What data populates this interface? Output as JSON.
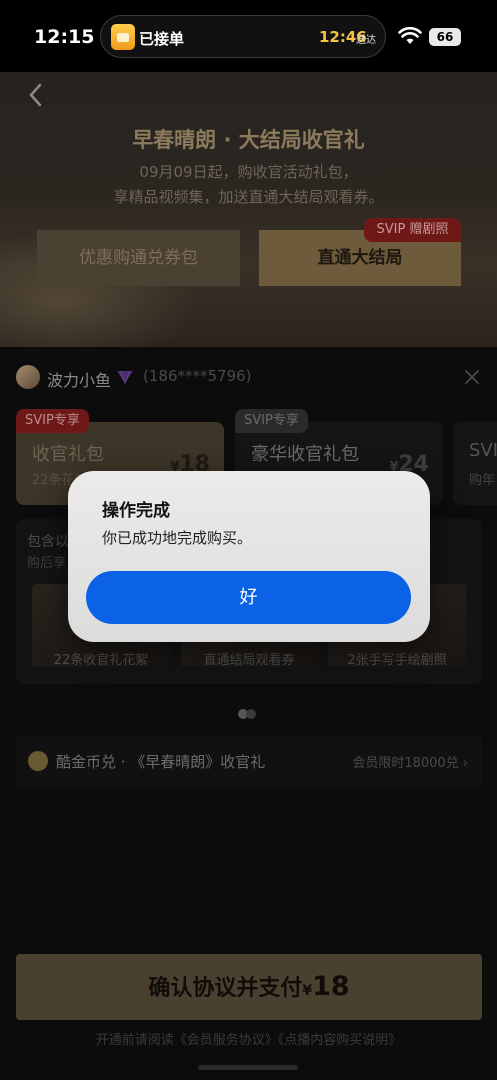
{
  "status_bar": {
    "time": "12:15",
    "island_text": "已接单",
    "island_time": "12:46",
    "island_sub": "送达",
    "battery": "66"
  },
  "banner": {
    "title": "早春晴朗 · 大结局收官礼",
    "desc_line1": "09月09日起，购收官活动礼包，",
    "desc_line2": "享精品视频集，加送直通大结局观看券。",
    "btn_coupon": "优惠购通兑券包",
    "btn_direct": "直通大结局",
    "badge": "SVIP 赠剧照"
  },
  "user": {
    "name": "波力小鱼",
    "phone": "(186****5796)"
  },
  "packages": [
    {
      "tag": "SVIP专享",
      "name": "收官礼包",
      "sub": "22条花絮",
      "price_symbol": "¥",
      "price": "18"
    },
    {
      "tag": "SVIP专享",
      "name": "豪华收官礼包",
      "sub": "",
      "price_symbol": "¥",
      "price": "24"
    },
    {
      "tag": "",
      "name": "SVI",
      "sub": "购年",
      "price_symbol": "",
      "price": ""
    }
  ],
  "includes": {
    "title": "包含以",
    "sub": "购后享",
    "items": [
      "22条收官礼花絮",
      "直通结局观看券",
      "2张手写手绘剧照"
    ]
  },
  "coin": {
    "label": "酷金币兑 · 《早春晴朗》收官礼",
    "right": "会员限时18000兑 ›"
  },
  "pay": {
    "label": "确认协议并支付",
    "symbol": "¥",
    "amount": "18",
    "agreement": "开通前请阅读《会员服务协议》《点播内容购买说明》"
  },
  "alert": {
    "title": "操作完成",
    "message": "你已成功地完成购买。",
    "ok": "好"
  }
}
